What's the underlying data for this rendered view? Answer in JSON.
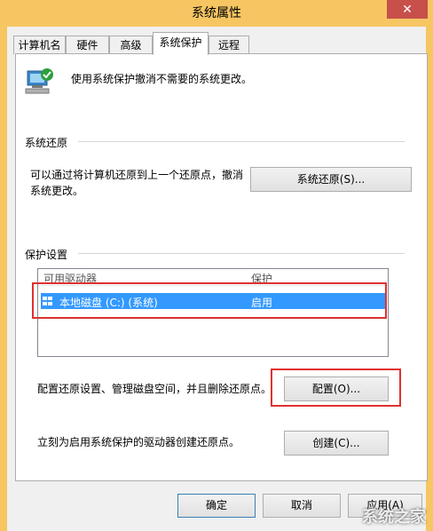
{
  "window": {
    "title": "系统属性",
    "close_glyph": "✕"
  },
  "tabs": [
    {
      "label": "计算机名"
    },
    {
      "label": "硬件"
    },
    {
      "label": "高级"
    },
    {
      "label": "系统保护",
      "active": true
    },
    {
      "label": "远程"
    }
  ],
  "intro": {
    "text": "使用系统保护撤消不需要的系统更改。"
  },
  "restore": {
    "section_title": "系统还原",
    "description": "可以通过将计算机还原到上一个还原点，撤消系统更改。",
    "button_label": "系统还原(S)..."
  },
  "protection": {
    "section_title": "保护设置",
    "columns": [
      "可用驱动器",
      "保护"
    ],
    "rows": [
      {
        "drive": "本地磁盘 (C:) (系统)",
        "status": "启用"
      }
    ],
    "configure_text": "配置还原设置、管理磁盘空间，并且删除还原点。",
    "configure_button": "配置(O)...",
    "create_text": "立刻为启用系统保护的驱动器创建还原点。",
    "create_button": "创建(C)..."
  },
  "footer": {
    "ok_label": "确定",
    "cancel_label": "取消",
    "apply_label": "应用(A)"
  },
  "watermark": {
    "text": "系统之家"
  },
  "colors": {
    "title_bar": "#f7c663",
    "selection": "#3399ff",
    "highlight_box": "#e03030"
  }
}
